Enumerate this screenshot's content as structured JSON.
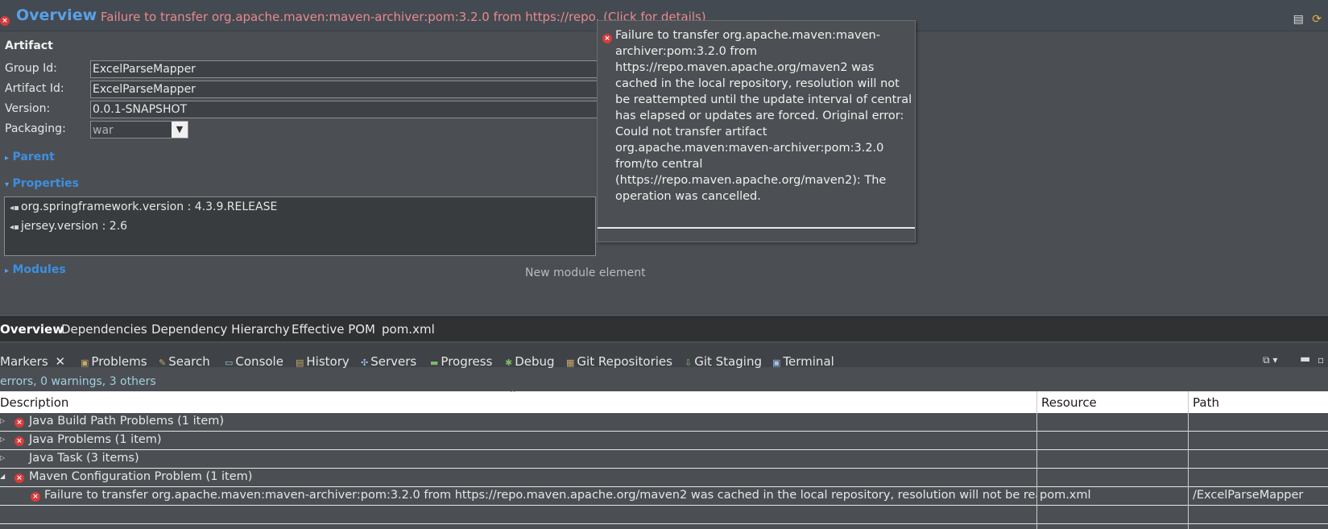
{
  "header": {
    "title": "Overview",
    "message": "Failure to transfer org.apache.maven:maven-archiver:pom:3.2.0 from https://repo. (Click for details)"
  },
  "artifact": {
    "section_title": "Artifact",
    "group_id_label": "Group Id:",
    "group_id_value": "ExcelParseMapper",
    "artifact_id_label": "Artifact Id:",
    "artifact_id_value": "ExcelParseMapper",
    "version_label": "Version:",
    "version_value": "0.0.1-SNAPSHOT",
    "packaging_label": "Packaging:",
    "packaging_value": "war"
  },
  "sections": {
    "parent": "Parent",
    "properties": "Properties",
    "modules": "Modules"
  },
  "properties": [
    "org.springframework.version : 4.3.9.RELEASE",
    "jersey.version : 2.6"
  ],
  "new_module": "New module element",
  "tooltip": {
    "text": "Failure to transfer org.apache.maven:maven-archiver:pom:3.2.0 from https://repo.maven.apache.org/maven2 was cached in the local repository, resolution will not be reattempted until the update interval of central has elapsed or updates are forced. Original error: Could not transfer artifact org.apache.maven:maven-archiver:pom:3.2.0 from/to central (https://repo.maven.apache.org/maven2): The operation was cancelled."
  },
  "editor_tabs": [
    "Overview",
    "Dependencies",
    "Dependency Hierarchy",
    "Effective POM",
    "pom.xml"
  ],
  "view_tabs": [
    "Markers",
    "Problems",
    "Search",
    "Console",
    "History",
    "Servers",
    "Progress",
    "Debug",
    "Git Repositories",
    "Git Staging",
    "Terminal"
  ],
  "markers": {
    "summary": "errors, 0 warnings, 3 others",
    "columns": {
      "description": "Description",
      "resource": "Resource",
      "path": "Path"
    },
    "rows": [
      {
        "description": "Java Build Path Problems (1 item)",
        "resource": "",
        "path": ""
      },
      {
        "description": "Java Problems (1 item)",
        "resource": "",
        "path": ""
      },
      {
        "description": "Java Task (3 items)",
        "resource": "",
        "path": ""
      },
      {
        "description": "Maven Configuration Problem (1 item)",
        "resource": "",
        "path": ""
      },
      {
        "description": "Failure to transfer org.apache.maven:maven-archiver:pom:3.2.0 from https://repo.maven.apache.org/maven2 was cached in the local repository, resolution will not be rea",
        "resource": "pom.xml",
        "path": "/ExcelParseMapper"
      }
    ]
  }
}
